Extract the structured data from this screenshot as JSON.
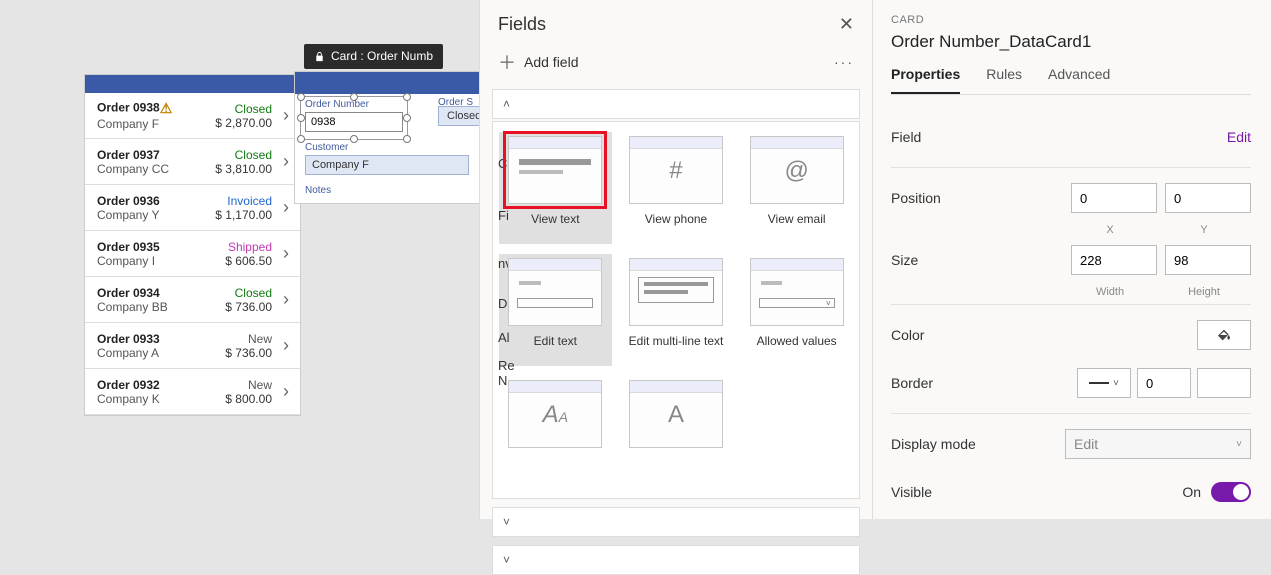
{
  "gallery": {
    "rows": [
      {
        "order": "Order 0938",
        "warn": true,
        "company": "Company F",
        "status": "Closed",
        "amount": "$ 2,870.00"
      },
      {
        "order": "Order 0937",
        "warn": false,
        "company": "Company CC",
        "status": "Closed",
        "amount": "$ 3,810.00"
      },
      {
        "order": "Order 0936",
        "warn": false,
        "company": "Company Y",
        "status": "Invoiced",
        "amount": "$ 1,170.00"
      },
      {
        "order": "Order 0935",
        "warn": false,
        "company": "Company I",
        "status": "Shipped",
        "amount": "$ 606.50"
      },
      {
        "order": "Order 0934",
        "warn": false,
        "company": "Company BB",
        "status": "Closed",
        "amount": "$ 736.00"
      },
      {
        "order": "Order 0933",
        "warn": false,
        "company": "Company A",
        "status": "New",
        "amount": "$ 736.00"
      },
      {
        "order": "Order 0932",
        "warn": false,
        "company": "Company K",
        "status": "New",
        "amount": "$ 800.00"
      }
    ]
  },
  "selection_tag": "Card : Order Numb",
  "form": {
    "order_number_label": "Order Number",
    "order_number_value": "0938",
    "order_status_label": "Order S",
    "order_status_value": "Closed",
    "customer_label": "Customer",
    "customer_value": "Company F",
    "notes_label": "Notes"
  },
  "fields_panel": {
    "title": "Fields",
    "add_field": "Add field",
    "peek": {
      "p1": "C",
      "p2": "Fi",
      "p3": "nv",
      "p4": "D",
      "p5": "Al",
      "p6": "Re\nN"
    },
    "types": [
      {
        "id": "view-text",
        "label": "View text",
        "selected": true,
        "highlight": true,
        "variant": "lines"
      },
      {
        "id": "view-phone",
        "label": "View phone",
        "selected": false,
        "highlight": false,
        "variant": "hash"
      },
      {
        "id": "view-email",
        "label": "View email",
        "selected": false,
        "highlight": false,
        "variant": "at"
      },
      {
        "id": "edit-text",
        "label": "Edit text",
        "selected": true,
        "highlight": false,
        "variant": "input"
      },
      {
        "id": "edit-multi",
        "label": "Edit multi-line text",
        "selected": false,
        "highlight": false,
        "variant": "multi"
      },
      {
        "id": "allowed",
        "label": "Allowed values",
        "selected": false,
        "highlight": false,
        "variant": "dropdown"
      },
      {
        "id": "aa1",
        "label": "",
        "selected": false,
        "highlight": false,
        "variant": "aa"
      },
      {
        "id": "aa2",
        "label": "",
        "selected": false,
        "highlight": false,
        "variant": "aaplain"
      }
    ]
  },
  "props": {
    "kicker": "CARD",
    "name": "Order Number_DataCard1",
    "tabs": {
      "properties": "Properties",
      "rules": "Rules",
      "advanced": "Advanced"
    },
    "field_label": "Field",
    "edit_link": "Edit",
    "position_label": "Position",
    "position_x": "0",
    "position_y": "0",
    "x_label": "X",
    "y_label": "Y",
    "size_label": "Size",
    "size_w": "228",
    "size_h": "98",
    "w_label": "Width",
    "h_label": "Height",
    "color_label": "Color",
    "border_label": "Border",
    "border_width": "0",
    "display_mode_label": "Display mode",
    "display_mode_value": "Edit",
    "visible_label": "Visible",
    "visible_state": "On"
  }
}
